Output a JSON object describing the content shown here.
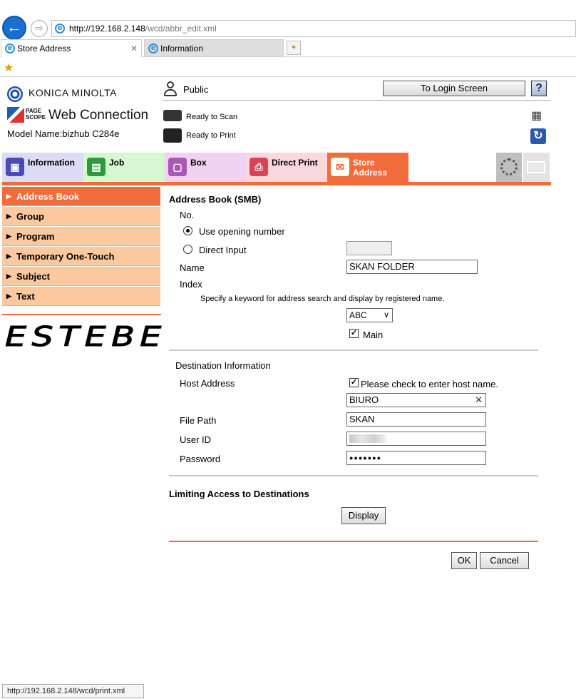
{
  "browser": {
    "url_host": "http://192.168.2.148",
    "url_path": "/wcd/abbr_edit.xml",
    "tabs": [
      {
        "label": "Store Address"
      },
      {
        "label": "Information"
      }
    ],
    "status_url": "http://192.168.2.148/wcd/print.xml"
  },
  "header": {
    "brand": "KONICA MINOLTA",
    "pagescope": "PAGE SCOPE",
    "product": "Web Connection",
    "model": "Model Name:bizhub C284e",
    "user": "Public",
    "login_button": "To Login Screen",
    "help": "?",
    "scan_status": "Ready to Scan",
    "print_status": "Ready to Print"
  },
  "main_tabs": [
    {
      "label": "Information"
    },
    {
      "label": "Job"
    },
    {
      "label": "Box"
    },
    {
      "label": "Direct Print"
    },
    {
      "label": "Store Address"
    }
  ],
  "sidebar": {
    "items": [
      {
        "label": "Address Book",
        "active": true
      },
      {
        "label": "Group"
      },
      {
        "label": "Program"
      },
      {
        "label": "Temporary One-Touch"
      },
      {
        "label": "Subject"
      },
      {
        "label": "Text"
      }
    ],
    "logo_text": "ESTEBE"
  },
  "form": {
    "title": "Address Book (SMB)",
    "no_label": "No.",
    "use_opening": "Use opening number",
    "direct_input": "Direct Input",
    "direct_input_value": "",
    "name_label": "Name",
    "name_value": "SKAN FOLDER",
    "index_label": "Index",
    "index_hint": "Specify a keyword for address search and display by registered name.",
    "index_value": "ABC",
    "main_label": "Main",
    "dest_title": "Destination Information",
    "host_label": "Host Address",
    "host_check": "Please check to enter host name.",
    "host_value": "BIURO",
    "filepath_label": "File Path",
    "filepath_value": "SKAN",
    "userid_label": "User ID",
    "password_label": "Password",
    "password_value": "●●●●●●●",
    "limit_title": "Limiting Access to Destinations",
    "display_button": "Display",
    "ok_button": "OK",
    "cancel_button": "Cancel"
  },
  "colors": {
    "accent": "#f26b3a",
    "sidebar": "#fbc99d"
  }
}
